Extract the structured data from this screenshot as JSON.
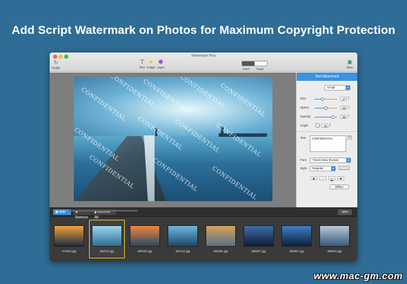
{
  "headline": "Add Script Watermark on Photos for Maximum Copyright Protection",
  "window": {
    "title": "Watermark Plus",
    "toolbar": {
      "profile_label": "Profile",
      "text_label": "Text",
      "image_label": "Image",
      "layer_label": "Layer",
      "batch_label": "Batch",
      "single_label": "Single",
      "save_label": "Save"
    }
  },
  "watermark_text": "CONFIDENTIAL",
  "panel": {
    "title": "Text Watermark",
    "style_value": "Script",
    "size_label": "Size",
    "size_value": "17",
    "space_label": "Space",
    "space_value": "50",
    "opacity_label": "Opacity",
    "opacity_value": "80",
    "angle_label": "Angle",
    "angle_value": "45",
    "text_label": "Text",
    "text_value": "CONFIDENTIAL",
    "font_label": "Font",
    "font_value": "Times New Roman",
    "style_label": "Style",
    "style_weight": "Regular",
    "format_buttons": [
      "B",
      "I",
      "U",
      "S"
    ],
    "effect_label": "Effect",
    "sliders": {
      "size": 0.35,
      "space": 0.5,
      "opacity": 0.8
    }
  },
  "bottom": {
    "add_label": "Add",
    "remove_label": "Remove",
    "remove_all_label": "Remove All",
    "zoom_value": "40%"
  },
  "thumbnails": [
    {
      "label": "474942.jpg",
      "colors": [
        "#f1a23a",
        "#1f2b40"
      ]
    },
    {
      "label": "552014.jpg",
      "colors": [
        "#9fd4ec",
        "#2d6e97"
      ],
      "selected": true
    },
    {
      "label": "589182.jpg",
      "colors": [
        "#f0863b",
        "#294866"
      ]
    },
    {
      "label": "594414.jpg",
      "colors": [
        "#6fb8de",
        "#1c4766"
      ]
    },
    {
      "label": "596364.jpg",
      "colors": [
        "#d7a25b",
        "#5a6f88"
      ]
    },
    {
      "label": "696927.jpg",
      "colors": [
        "#3f6ea6",
        "#0f1c35"
      ]
    },
    {
      "label": "696937.jpg",
      "colors": [
        "#3d80c4",
        "#0d1f3d"
      ]
    },
    {
      "label": "696943.jpg",
      "colors": [
        "#b9c9d8",
        "#37597a"
      ]
    }
  ],
  "site_watermark": "www.mac-gm.com"
}
